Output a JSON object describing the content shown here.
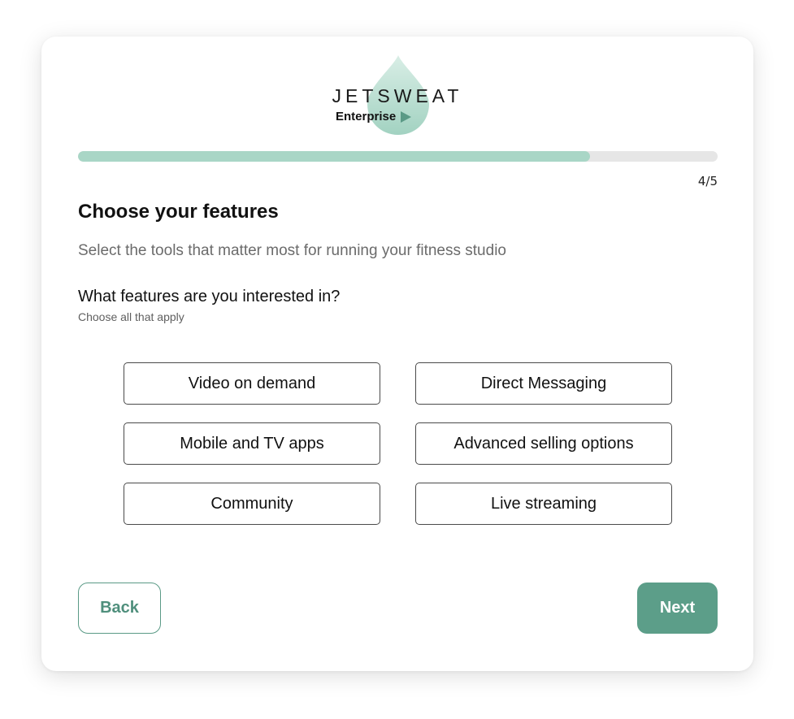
{
  "brand": {
    "name": "JETSWEAT",
    "tier": "Enterprise",
    "accent_color": "#5c9e89",
    "drop_color": "#a9d6c6"
  },
  "progress": {
    "fraction": 0.8,
    "label": "4/5"
  },
  "page": {
    "title": "Choose your features",
    "subtitle": "Select the tools that matter most for running your fitness studio"
  },
  "question": {
    "label": "What features are you interested in?",
    "hint": "Choose all that apply"
  },
  "options": [
    {
      "label": "Video on demand"
    },
    {
      "label": "Direct Messaging"
    },
    {
      "label": "Mobile and TV apps"
    },
    {
      "label": "Advanced selling options"
    },
    {
      "label": "Community"
    },
    {
      "label": "Live streaming"
    }
  ],
  "buttons": {
    "back_label": "Back",
    "next_label": "Next"
  }
}
